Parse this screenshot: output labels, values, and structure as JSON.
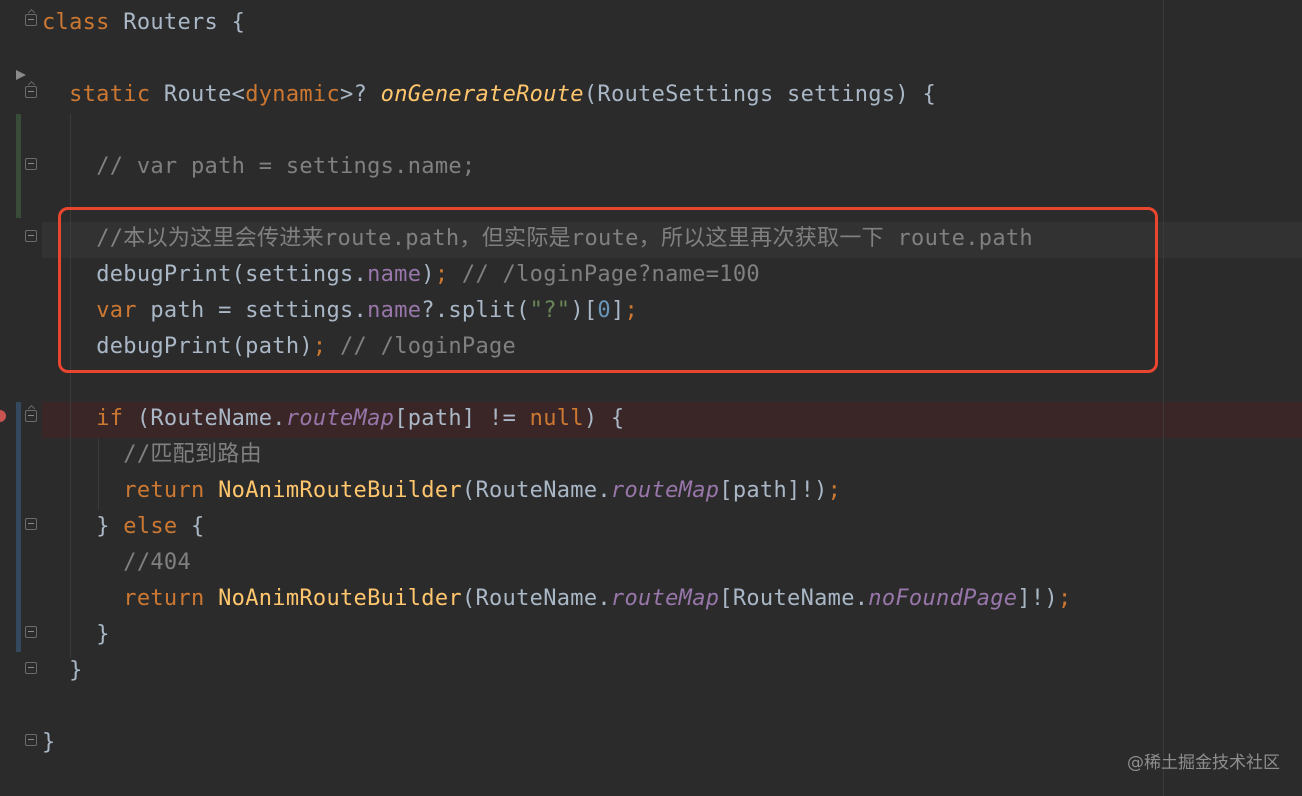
{
  "editor": {
    "lines": [
      {
        "tokens": [
          {
            "t": "class",
            "c": "kw"
          },
          {
            "t": " Routers {",
            "c": "txt"
          }
        ]
      },
      {
        "tokens": []
      },
      {
        "tokens": [
          {
            "t": "  "
          },
          {
            "t": "static",
            "c": "kw"
          },
          {
            "t": " Route<",
            "c": "txt"
          },
          {
            "t": "dynamic",
            "c": "kw"
          },
          {
            "t": ">? ",
            "c": "txt"
          },
          {
            "t": "onGenerateRoute",
            "c": "fn"
          },
          {
            "t": "(RouteSettings settings) {",
            "c": "txt"
          }
        ]
      },
      {
        "tokens": []
      },
      {
        "tokens": [
          {
            "t": "    "
          },
          {
            "t": "// var path = settings.name;",
            "c": "cmt"
          }
        ]
      },
      {
        "tokens": []
      },
      {
        "tokens": [
          {
            "t": "    "
          },
          {
            "t": "//本以为这里会传进来route.path，但实际是route，所以这里再次获取一下 route.path",
            "c": "cmt"
          }
        ]
      },
      {
        "tokens": [
          {
            "t": "    "
          },
          {
            "t": "debugPrint(settings.",
            "c": "txt"
          },
          {
            "t": "name",
            "c": "field"
          },
          {
            "t": ")",
            "c": "txt"
          },
          {
            "t": ";",
            "c": "punc"
          },
          {
            "t": " // /loginPage?name=100",
            "c": "cmt"
          }
        ]
      },
      {
        "tokens": [
          {
            "t": "    "
          },
          {
            "t": "var",
            "c": "kw"
          },
          {
            "t": " path = settings.",
            "c": "txt"
          },
          {
            "t": "name",
            "c": "field"
          },
          {
            "t": "?.split(",
            "c": "txt"
          },
          {
            "t": "\"?\"",
            "c": "str"
          },
          {
            "t": ")[",
            "c": "txt"
          },
          {
            "t": "0",
            "c": "num"
          },
          {
            "t": "]",
            "c": "txt"
          },
          {
            "t": ";",
            "c": "punc"
          }
        ]
      },
      {
        "tokens": [
          {
            "t": "    "
          },
          {
            "t": "debugPrint(path)",
            "c": "txt"
          },
          {
            "t": ";",
            "c": "punc"
          },
          {
            "t": " // /loginPage",
            "c": "cmt"
          }
        ]
      },
      {
        "tokens": []
      },
      {
        "tokens": [
          {
            "t": "    "
          },
          {
            "t": "if",
            "c": "kw"
          },
          {
            "t": " (RouteName.",
            "c": "txt"
          },
          {
            "t": "routeMap",
            "c": "ifield"
          },
          {
            "t": "[path] != ",
            "c": "txt"
          },
          {
            "t": "null",
            "c": "kw"
          },
          {
            "t": ") {",
            "c": "txt"
          }
        ]
      },
      {
        "tokens": [
          {
            "t": "      "
          },
          {
            "t": "//匹配到路由",
            "c": "cmt"
          }
        ]
      },
      {
        "tokens": [
          {
            "t": "      "
          },
          {
            "t": "return",
            "c": "kw"
          },
          {
            "t": " ",
            "c": "txt"
          },
          {
            "t": "NoAnimRouteBuilder",
            "c": "cl"
          },
          {
            "t": "(RouteName.",
            "c": "txt"
          },
          {
            "t": "routeMap",
            "c": "ifield"
          },
          {
            "t": "[path]!)",
            "c": "txt"
          },
          {
            "t": ";",
            "c": "punc"
          }
        ]
      },
      {
        "tokens": [
          {
            "t": "    "
          },
          {
            "t": "} ",
            "c": "txt"
          },
          {
            "t": "else",
            "c": "kw"
          },
          {
            "t": " {",
            "c": "txt"
          }
        ]
      },
      {
        "tokens": [
          {
            "t": "      "
          },
          {
            "t": "//404",
            "c": "cmt"
          }
        ]
      },
      {
        "tokens": [
          {
            "t": "      "
          },
          {
            "t": "return",
            "c": "kw"
          },
          {
            "t": " ",
            "c": "txt"
          },
          {
            "t": "NoAnimRouteBuilder",
            "c": "cl"
          },
          {
            "t": "(RouteName.",
            "c": "txt"
          },
          {
            "t": "routeMap",
            "c": "ifield"
          },
          {
            "t": "[RouteName.",
            "c": "txt"
          },
          {
            "t": "noFoundPage",
            "c": "ifield"
          },
          {
            "t": "]!)",
            "c": "txt"
          },
          {
            "t": ";",
            "c": "punc"
          }
        ]
      },
      {
        "tokens": [
          {
            "t": "    "
          },
          {
            "t": "}",
            "c": "txt"
          }
        ]
      },
      {
        "tokens": [
          {
            "t": "  "
          },
          {
            "t": "}",
            "c": "txt"
          }
        ]
      },
      {
        "tokens": []
      },
      {
        "tokens": [
          {
            "t": "}",
            "c": "txt"
          }
        ]
      }
    ]
  },
  "watermark": "@稀土掘金技术社区",
  "colors": {
    "annotation": "#e8462e",
    "background": "#2b2b2b"
  }
}
